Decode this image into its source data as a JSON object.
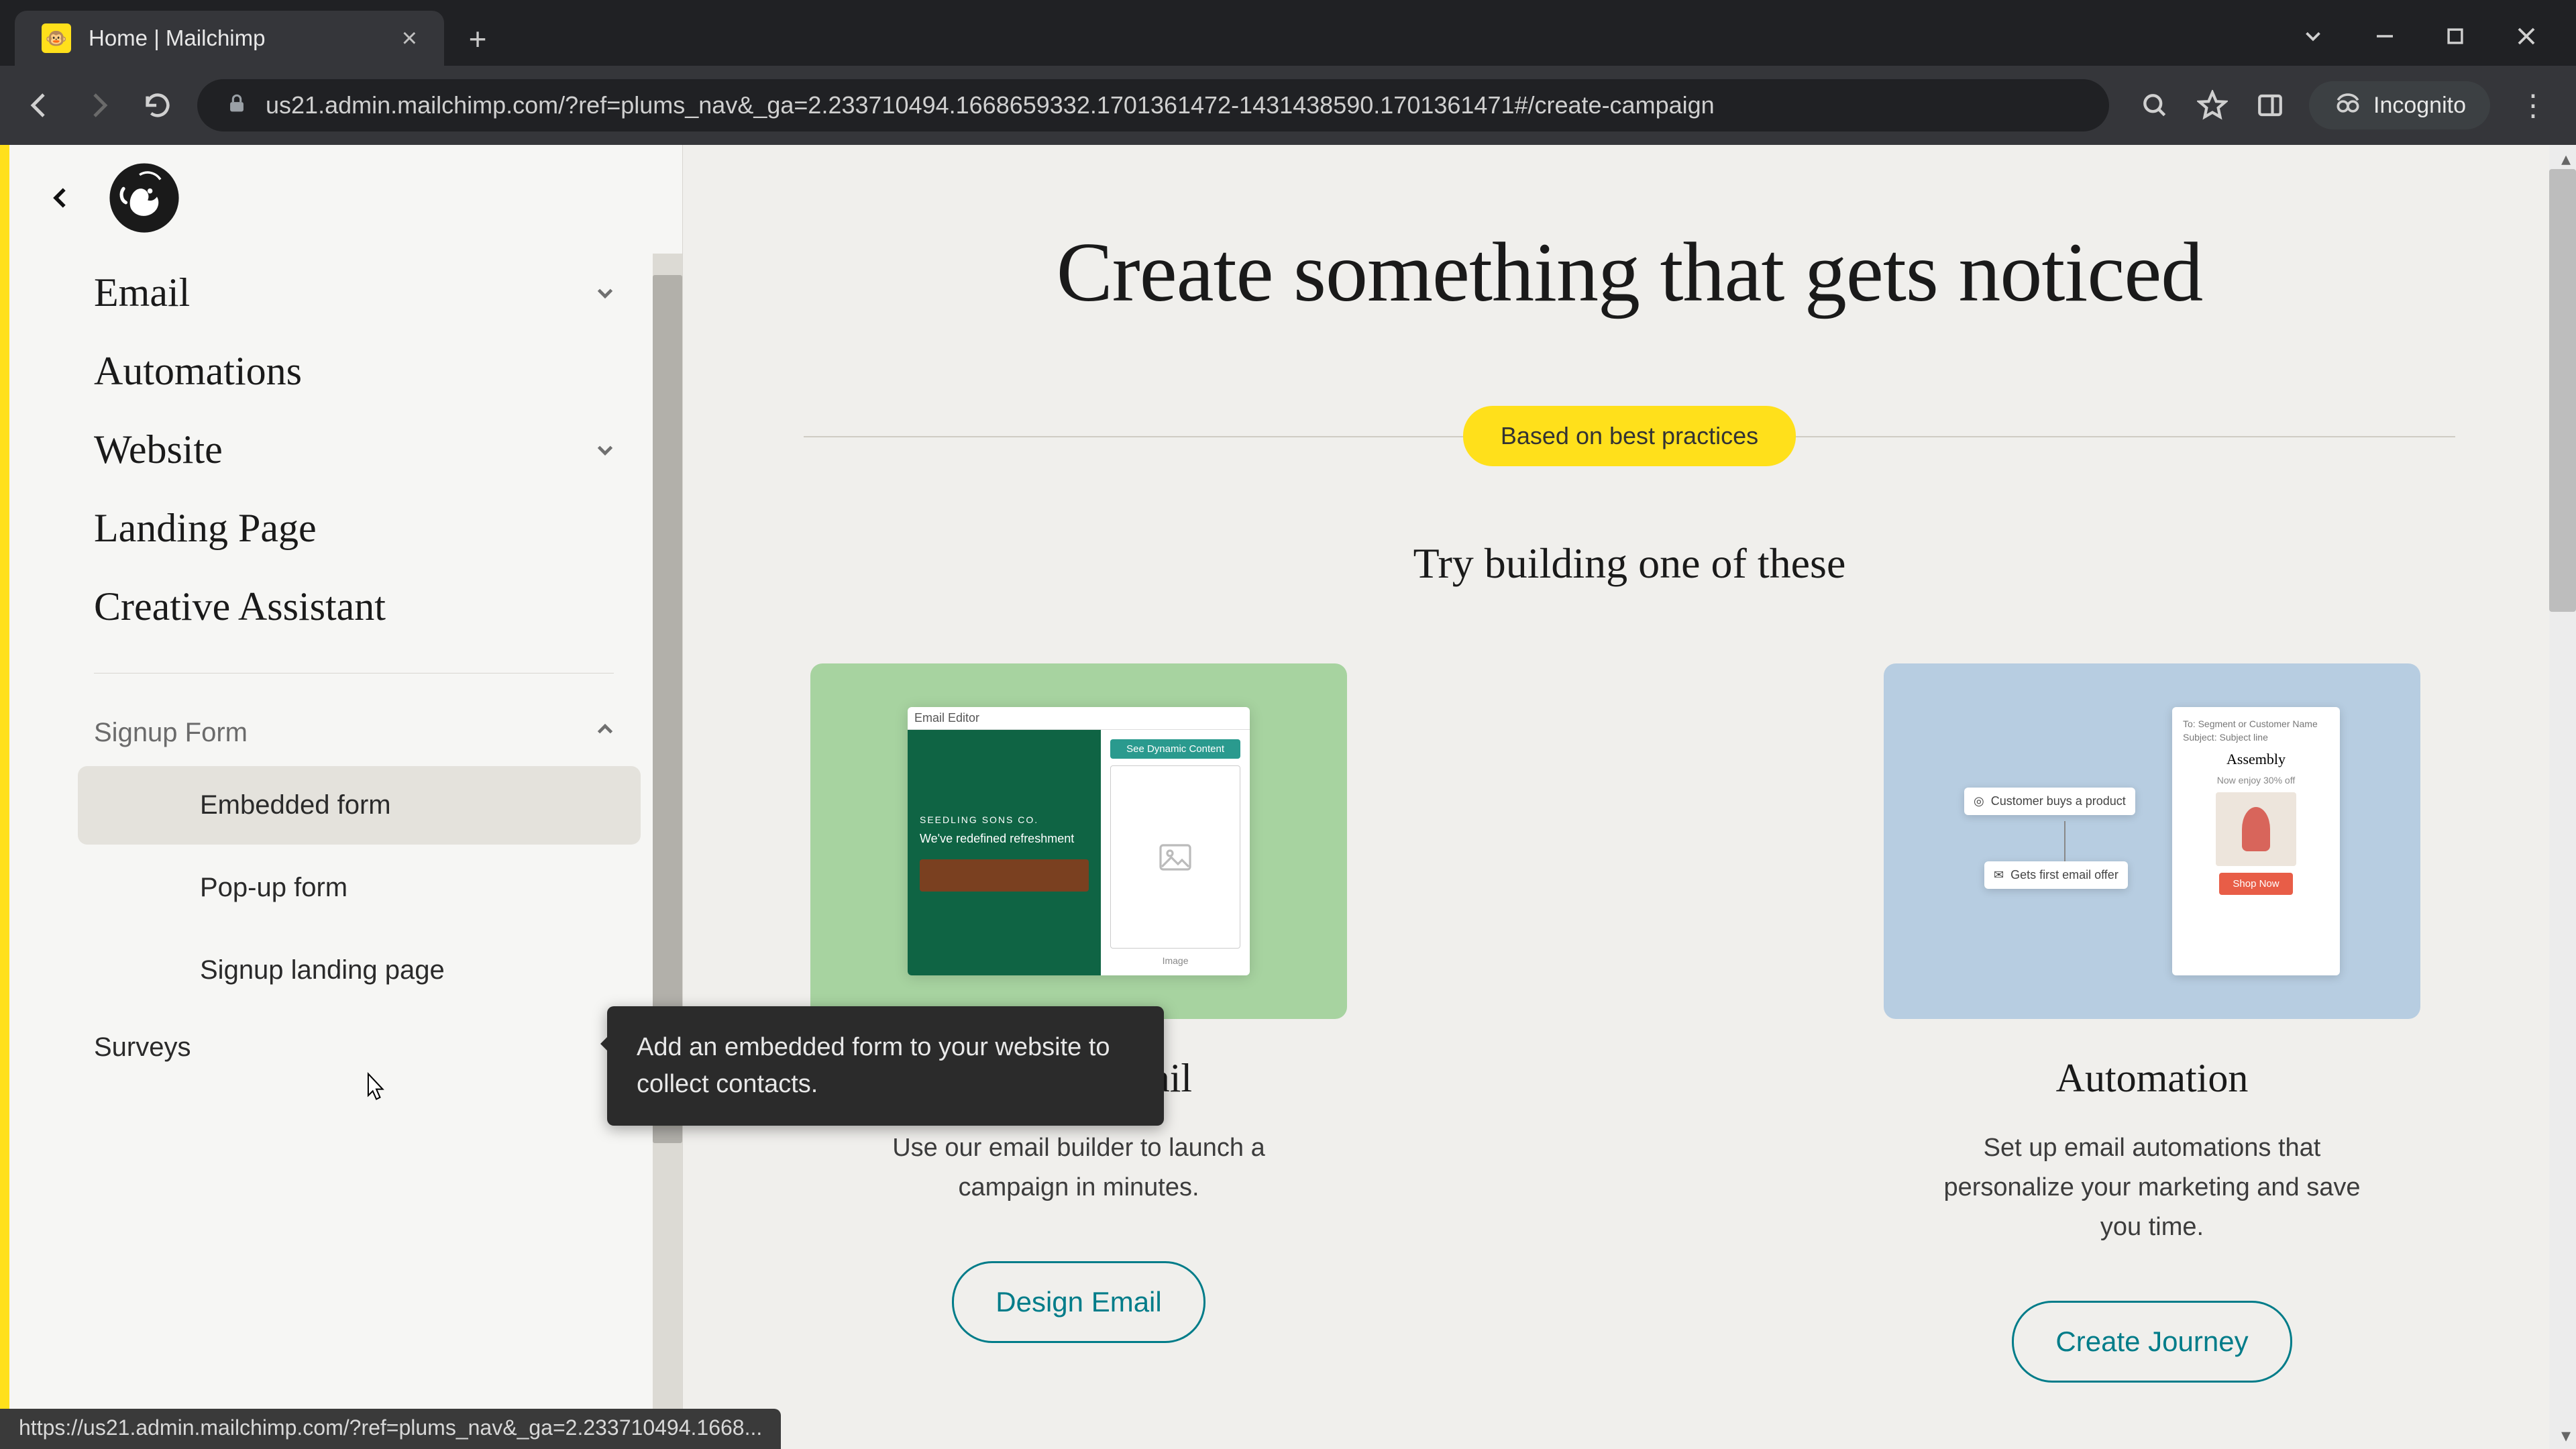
{
  "browser": {
    "tab_title": "Home | Mailchimp",
    "url": "us21.admin.mailchimp.com/?ref=plums_nav&_ga=2.233710494.1668659332.1701361472-1431438590.1701361471#/create-campaign",
    "incognito_label": "Incognito",
    "status_url": "https://us21.admin.mailchimp.com/?ref=plums_nav&_ga=2.233710494.1668..."
  },
  "sidebar": {
    "items": [
      {
        "label": "Email",
        "expandable": true
      },
      {
        "label": "Automations",
        "expandable": false
      },
      {
        "label": "Website",
        "expandable": true
      },
      {
        "label": "Landing Page",
        "expandable": false
      },
      {
        "label": "Creative Assistant",
        "expandable": false
      }
    ],
    "group": {
      "title": "Signup Form",
      "items": [
        {
          "label": "Embedded form"
        },
        {
          "label": "Pop-up form"
        },
        {
          "label": "Signup landing page"
        }
      ]
    },
    "trailing": {
      "label": "Surveys"
    }
  },
  "tooltip": {
    "text": "Add an embedded form to your website to collect contacts."
  },
  "main": {
    "hero_title": "Create something that gets noticed",
    "pill": "Based on best practices",
    "try_line": "Try building one of these",
    "cards": [
      {
        "title": "Regular email",
        "desc": "Use our email builder to launch a campaign in minutes.",
        "cta": "Design Email",
        "art": {
          "header": "Email Editor",
          "seedling": "SEEDLING SONS CO.",
          "headline": "We've redefined refreshment",
          "btn": "See Dynamic Content",
          "placeholder": "Image"
        }
      },
      {
        "title": "Automation",
        "desc": "Set up email automations that personalize your marketing and save you time.",
        "cta": "Create Journey",
        "art": {
          "trigger": "Customer buys a product",
          "action": "Gets first email offer",
          "hdr_line1": "To: Segment or Customer Name",
          "hdr_line2": "Subject: Subject line",
          "title": "Assembly",
          "sub": "Now enjoy 30% off",
          "cta": "Shop Now"
        }
      }
    ]
  }
}
